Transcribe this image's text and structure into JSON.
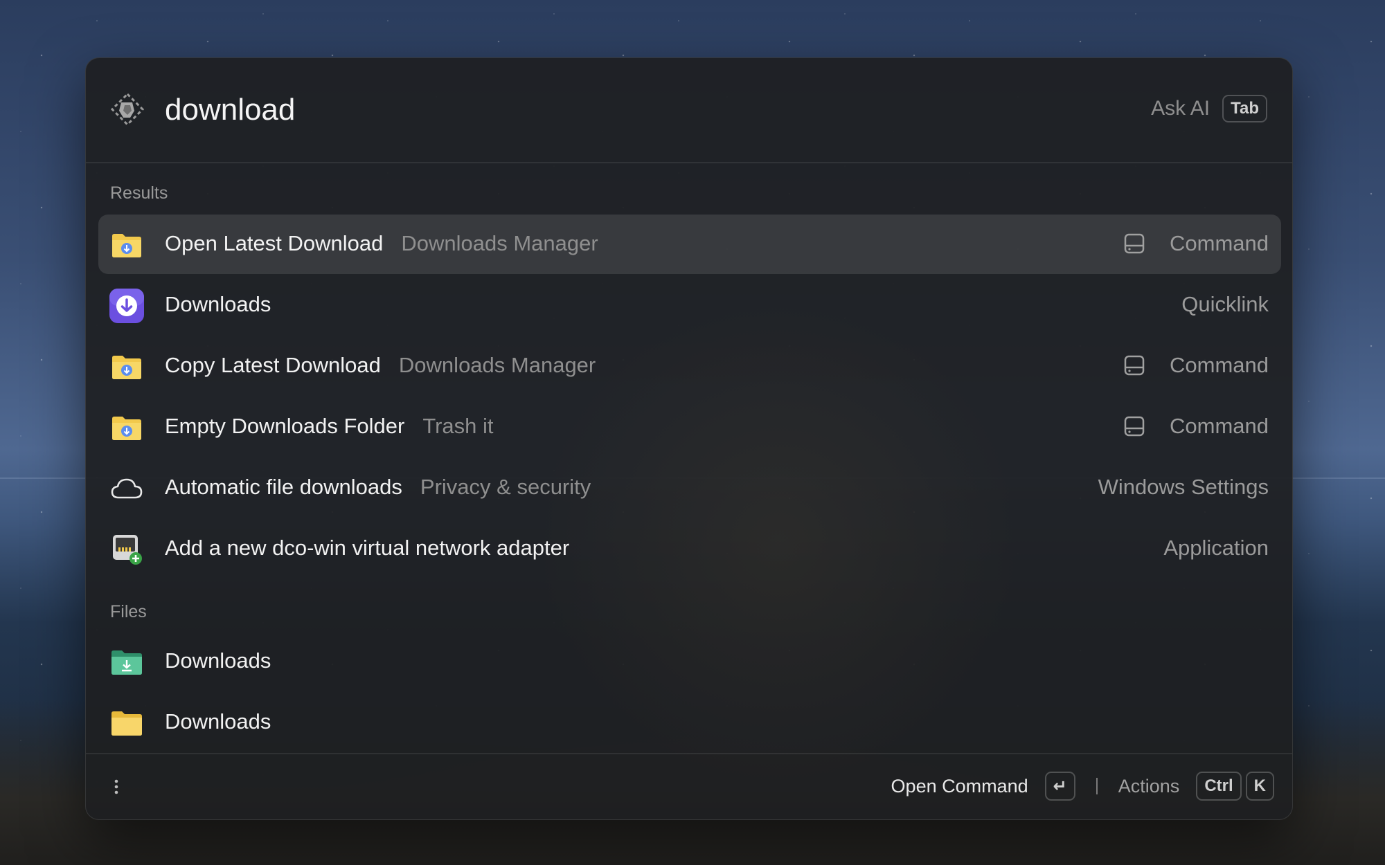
{
  "search": {
    "value": "download",
    "ask_ai_label": "Ask AI",
    "ask_ai_key": "Tab"
  },
  "sections": {
    "results_label": "Results",
    "files_label": "Files"
  },
  "results": [
    {
      "title": "Open Latest Download",
      "subtitle": "Downloads Manager",
      "type": "Command",
      "icon": "download-folder-icon",
      "selected": true
    },
    {
      "title": "Downloads",
      "subtitle": "",
      "type": "Quicklink",
      "icon": "download-circle-icon",
      "selected": false
    },
    {
      "title": "Copy Latest Download",
      "subtitle": "Downloads Manager",
      "type": "Command",
      "icon": "download-folder-icon",
      "selected": false
    },
    {
      "title": "Empty Downloads Folder",
      "subtitle": "Trash it",
      "type": "Command",
      "icon": "download-folder-icon",
      "selected": false
    },
    {
      "title": "Automatic file downloads",
      "subtitle": "Privacy & security",
      "type": "Windows Settings",
      "icon": "cloud-icon",
      "selected": false
    },
    {
      "title": "Add a new dco-win virtual network adapter",
      "subtitle": "",
      "type": "Application",
      "icon": "network-adapter-icon",
      "selected": false
    }
  ],
  "files": [
    {
      "title": "Downloads",
      "icon": "green-download-folder-icon"
    },
    {
      "title": "Downloads",
      "icon": "yellow-folder-icon"
    }
  ],
  "footer": {
    "primary_action": "Open Command",
    "primary_key": "↵",
    "actions_label": "Actions",
    "actions_keys": [
      "Ctrl",
      "K"
    ]
  },
  "colors": {
    "panel_background": "#1e1f21",
    "selected_row": "#39393b",
    "folder_yellow": "#f2c94c",
    "download_badge_blue": "#5b8def",
    "quicklink_purple": "#6b4fe0"
  }
}
